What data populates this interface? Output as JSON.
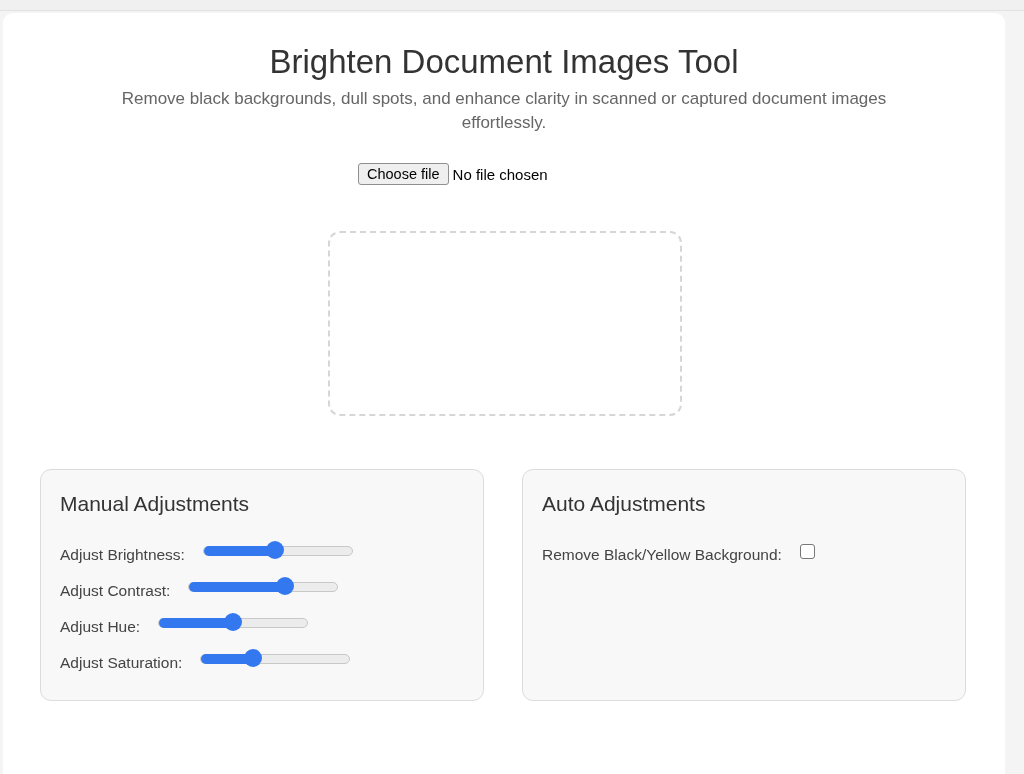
{
  "title": "Brighten Document Images Tool",
  "subtitle": "Remove black backgrounds, dull spots, and enhance clarity in scanned or captured document images effortlessly.",
  "file_input": {
    "button": "Choose file",
    "status": "No file chosen"
  },
  "manual": {
    "heading": "Manual Adjustments",
    "sliders": [
      {
        "label": "Adjust Brightness:",
        "level": 0.48
      },
      {
        "label": "Adjust Contrast:",
        "level": 0.65
      },
      {
        "label": "Adjust Hue:",
        "level": 0.5
      },
      {
        "label": "Adjust Saturation:",
        "level": 0.35
      }
    ]
  },
  "auto": {
    "heading": "Auto Adjustments",
    "options": [
      {
        "label": "Remove Black/Yellow Background:",
        "checked": false
      }
    ]
  }
}
